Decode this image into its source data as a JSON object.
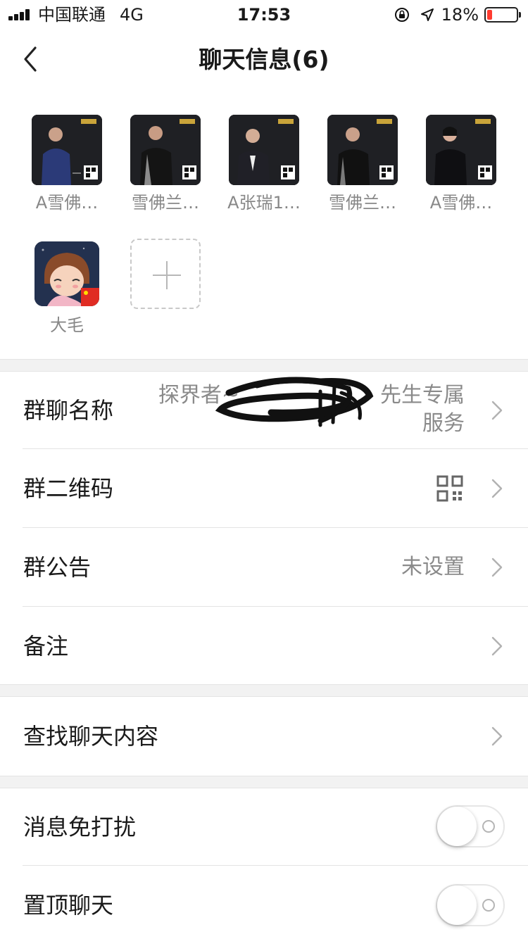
{
  "status_bar": {
    "carrier": "中国联通",
    "network": "4G",
    "time": "17:53",
    "battery_percent": "18%",
    "battery_level": 0.18,
    "battery_color": "#ff3b30"
  },
  "nav": {
    "title": "聊天信息(6)",
    "back_icon": "chevron-left-icon"
  },
  "members": [
    {
      "name": "A雪佛…",
      "avatar_kind": "photo"
    },
    {
      "name": "雪佛兰…",
      "avatar_kind": "photo"
    },
    {
      "name": "A张瑞1…",
      "avatar_kind": "photo"
    },
    {
      "name": "雪佛兰…",
      "avatar_kind": "photo"
    },
    {
      "name": "A雪佛…",
      "avatar_kind": "photo"
    },
    {
      "name": "大毛",
      "avatar_kind": "cartoon"
    }
  ],
  "add_member_icon": "plus-icon",
  "settings": {
    "group_name": {
      "label": "群聊名称",
      "value": "探界者~…先生专属服务",
      "value_line1": "探界者~",
      "value_line1_tail": "先生专属",
      "value_line2": "服务"
    },
    "group_qr": {
      "label": "群二维码",
      "icon": "qr-code-icon"
    },
    "announcement": {
      "label": "群公告",
      "value": "未设置"
    },
    "remark": {
      "label": "备注"
    },
    "search_history": {
      "label": "查找聊天内容"
    },
    "mute": {
      "label": "消息免打扰",
      "on": false
    },
    "pin": {
      "label": "置顶聊天",
      "on": false
    }
  },
  "colors": {
    "background": "#ffffff",
    "section_gap": "#f2f2f2",
    "label_text": "#1a1a1a",
    "secondary_text": "#8a8a8a"
  }
}
